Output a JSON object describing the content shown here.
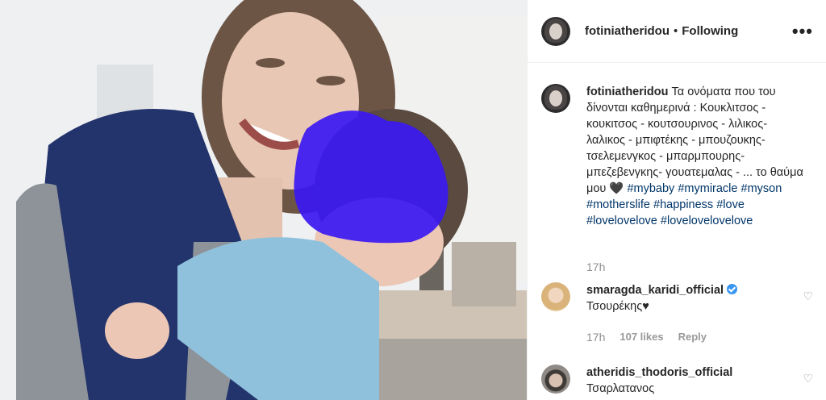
{
  "post": {
    "author": "fotiniatheridou",
    "separator": "•",
    "follow_status": "Following",
    "more_icon": "•••",
    "caption_text": "Τα ονόματα που του δίνονται καθημερινά : Κουκλιτσος - κουκιτσος - κουτσουρινος - λιλικος- λαλικος - μπιφτέκης - μπουζουκης- τσελεμενγκος - μπαρμπουρης- μπεζεβενγκης- γουατεμαλας - ... το θαύμα μου 🖤",
    "hashtags": [
      "#mybaby",
      "#mymiracle",
      "#myson",
      "#motherslife",
      "#happiness",
      "#love",
      "#lovelovelove",
      "#lovelovelovelove"
    ],
    "time": "17h"
  },
  "comments": [
    {
      "username": "smaragda_karidi_official",
      "verified": true,
      "text": "Τσουρέκης♥",
      "time": "17h",
      "likes": "107 likes",
      "reply": "Reply",
      "heart_icon": "♡"
    },
    {
      "username": "atheridis_thodoris_official",
      "verified": false,
      "text": "Τσαρλατανος",
      "heart_icon": "♡"
    }
  ],
  "colors": {
    "hashtag": "#003569",
    "secondary_text": "#8e8e8e",
    "verified": "#3897f0",
    "blur_overlay": "#3b18f2"
  }
}
